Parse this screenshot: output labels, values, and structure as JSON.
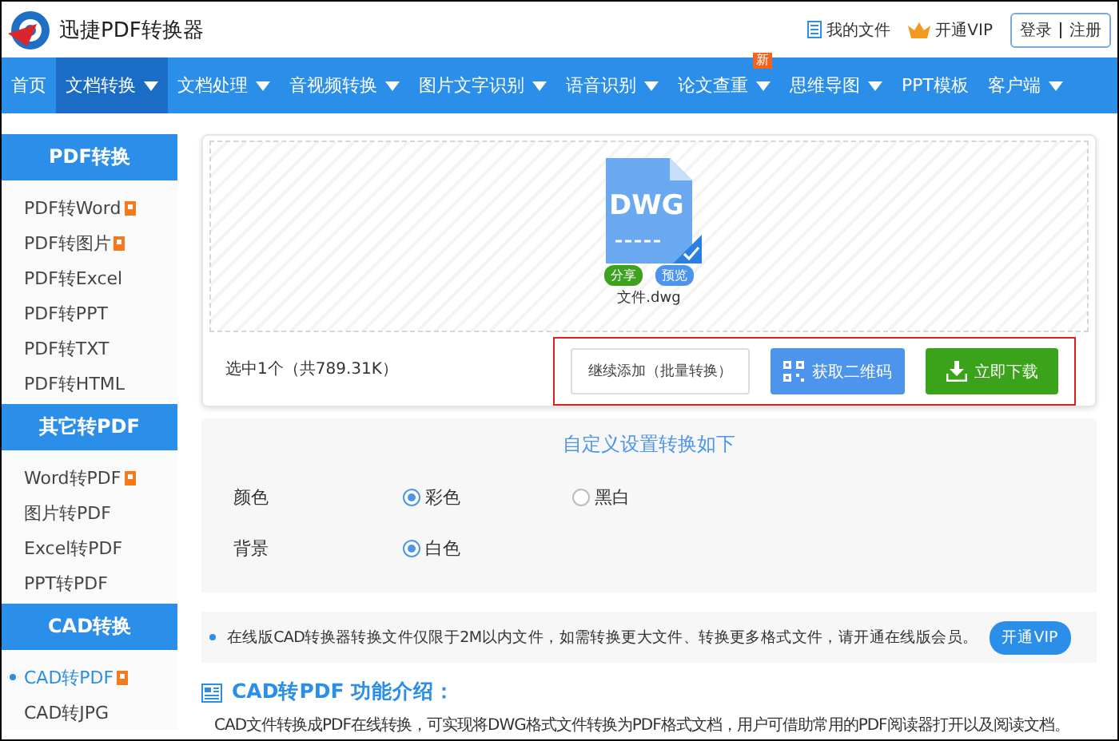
{
  "header": {
    "logo_text": "迅捷PDF转换器",
    "my_files": "我的文件",
    "vip": "开通VIP",
    "login": "登录",
    "register": "注册"
  },
  "nav": [
    {
      "label": "首页",
      "selected": false,
      "dropdown": false
    },
    {
      "label": "文档转换",
      "selected": true,
      "dropdown": true
    },
    {
      "label": "文档处理",
      "selected": false,
      "dropdown": true
    },
    {
      "label": "音视频转换",
      "selected": false,
      "dropdown": true
    },
    {
      "label": "图片文字识别",
      "selected": false,
      "dropdown": true
    },
    {
      "label": "语音识别",
      "selected": false,
      "dropdown": true
    },
    {
      "label": "论文查重",
      "selected": false,
      "dropdown": true,
      "badge": "新"
    },
    {
      "label": "思维导图",
      "selected": false,
      "dropdown": true
    },
    {
      "label": "PPT模板",
      "selected": false,
      "dropdown": false
    },
    {
      "label": "客户端",
      "selected": false,
      "dropdown": true
    }
  ],
  "sidebar": [
    {
      "title": "PDF转换",
      "items": [
        {
          "label": "PDF转Word",
          "hot": true,
          "selected": false
        },
        {
          "label": "PDF转图片",
          "hot": true,
          "selected": false
        },
        {
          "label": "PDF转Excel",
          "hot": false,
          "selected": false
        },
        {
          "label": "PDF转PPT",
          "hot": false,
          "selected": false
        },
        {
          "label": "PDF转TXT",
          "hot": false,
          "selected": false
        },
        {
          "label": "PDF转HTML",
          "hot": false,
          "selected": false
        }
      ]
    },
    {
      "title": "其它转PDF",
      "items": [
        {
          "label": "Word转PDF",
          "hot": true,
          "selected": false
        },
        {
          "label": "图片转PDF",
          "hot": false,
          "selected": false
        },
        {
          "label": "Excel转PDF",
          "hot": false,
          "selected": false
        },
        {
          "label": "PPT转PDF",
          "hot": false,
          "selected": false
        }
      ]
    },
    {
      "title": "CAD转换",
      "items": [
        {
          "label": "CAD转PDF",
          "hot": true,
          "selected": true
        },
        {
          "label": "CAD转JPG",
          "hot": false,
          "selected": false
        }
      ]
    }
  ],
  "upload": {
    "file": {
      "type_label": "DWG",
      "name": "文件.dwg",
      "checked": true,
      "share": "分享",
      "preview": "预览"
    },
    "summary": "选中1个（共789.31K）",
    "add_button": "继续添加（批量转换）",
    "qr_button": "获取二维码",
    "download_button": "立即下载"
  },
  "settings": {
    "title": "自定义设置转换如下",
    "rows": [
      {
        "label": "颜色",
        "options": [
          {
            "label": "彩色",
            "selected": true
          },
          {
            "label": "黑白",
            "selected": false
          }
        ]
      },
      {
        "label": "背景",
        "options": [
          {
            "label": "白色",
            "selected": true
          }
        ]
      }
    ]
  },
  "notice": {
    "text": "在线版CAD转换器转换文件仅限于2M以内文件，如需转换更大文件、转换更多格式文件，请开通在线版会员。",
    "button": "开通VIP"
  },
  "intro": {
    "title": "CAD转PDF 功能介绍：",
    "text": "CAD文件转换成PDF在线转换，可实现将DWG格式文件转换为PDF格式文档，用户可借助常用的PDF阅读器打开以及阅读文档。"
  }
}
